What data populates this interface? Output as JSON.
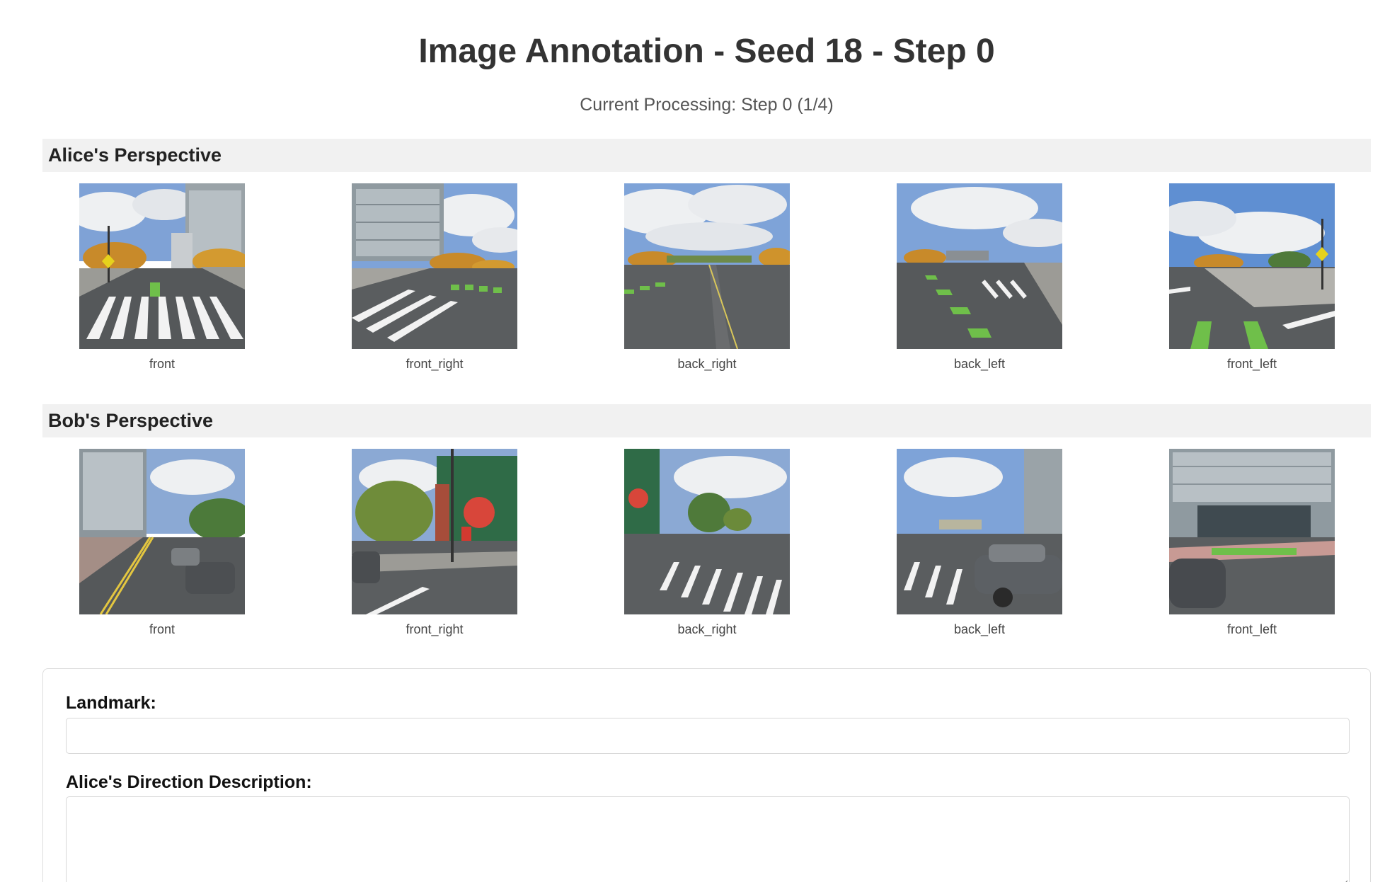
{
  "page": {
    "title": "Image Annotation - Seed 18 - Step 0",
    "subtitle": "Current Processing: Step 0 (1/4)"
  },
  "alice": {
    "header": "Alice's Perspective",
    "views": [
      {
        "label": "front",
        "image": "street-view-front"
      },
      {
        "label": "front_right",
        "image": "street-view-front-right"
      },
      {
        "label": "back_right",
        "image": "street-view-back-right"
      },
      {
        "label": "back_left",
        "image": "street-view-back-left"
      },
      {
        "label": "front_left",
        "image": "street-view-front-left"
      }
    ]
  },
  "bob": {
    "header": "Bob's Perspective",
    "views": [
      {
        "label": "front",
        "image": "street-view-front"
      },
      {
        "label": "front_right",
        "image": "street-view-front-right"
      },
      {
        "label": "back_right",
        "image": "street-view-back-right"
      },
      {
        "label": "back_left",
        "image": "street-view-back-left"
      },
      {
        "label": "front_left",
        "image": "street-view-front-left"
      }
    ]
  },
  "form": {
    "landmark_label": "Landmark:",
    "landmark_value": "",
    "direction_label": "Alice's Direction Description:",
    "direction_value": ""
  },
  "colors": {
    "section_bg": "#f1f1f1",
    "sky": "#6d95cf",
    "cloud": "#eef0f2",
    "road": "#55585a",
    "bike_lane": "#6fbf4a",
    "foliage": "#c88a2a"
  }
}
